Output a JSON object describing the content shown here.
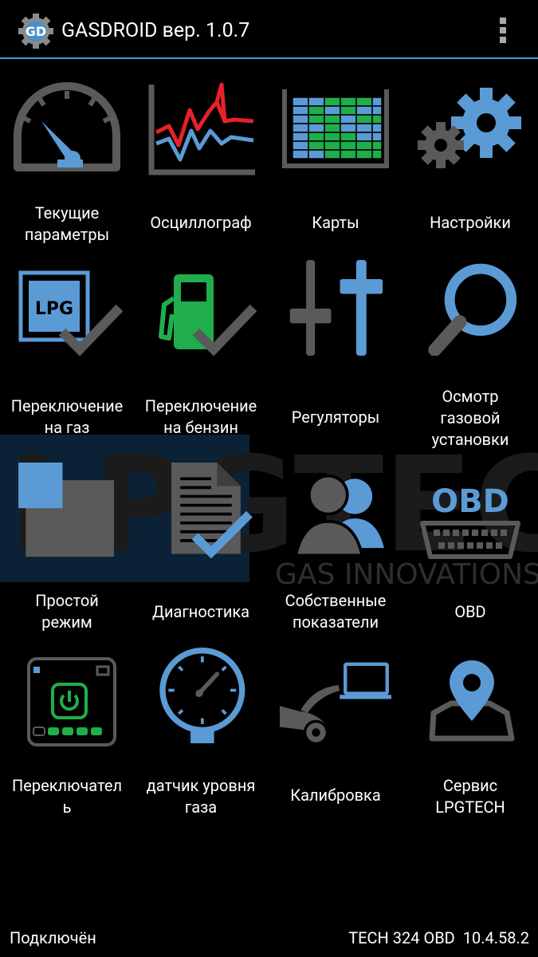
{
  "header": {
    "title": "GASDROID вер. 1.0.7",
    "logo_letters": "GD",
    "menu_icon": "overflow-menu-icon"
  },
  "watermark": {
    "brand": "LPGTECH",
    "tagline": "GAS INNOVATIONS"
  },
  "tiles": [
    {
      "label": "Текущие\nпараметры",
      "icon": "speedometer-icon"
    },
    {
      "label": "Осциллограф",
      "icon": "oscillograph-icon"
    },
    {
      "label": "Карты",
      "icon": "map-grid-icon"
    },
    {
      "label": "Настройки",
      "icon": "gears-icon"
    },
    {
      "label": "Переключение\nна газ",
      "icon": "lpg-check-icon",
      "icon_text": "LPG"
    },
    {
      "label": "Переключение\nна бензин",
      "icon": "fuel-pump-check-icon"
    },
    {
      "label": "Регуляторы",
      "icon": "sliders-icon"
    },
    {
      "label": "Осмотр\nгазовой\nустановки",
      "icon": "magnifier-icon"
    },
    {
      "label": "Простой\nрежим",
      "icon": "simple-mode-icon"
    },
    {
      "label": "Диагностика",
      "icon": "diagnostics-document-icon"
    },
    {
      "label": "Собственные\nпоказатели",
      "icon": "users-icon"
    },
    {
      "label": "OBD",
      "icon": "obd-connector-icon",
      "icon_text": "OBD"
    },
    {
      "label": "Переключател\nь",
      "icon": "switch-panel-icon"
    },
    {
      "label": "датчик уровня\nгаза",
      "icon": "gas-level-gauge-icon"
    },
    {
      "label": "Калибровка",
      "icon": "car-laptop-icon"
    },
    {
      "label": "Сервис\nLPGTECH",
      "icon": "map-pin-icon"
    }
  ],
  "footer": {
    "status": "Подключён",
    "device": "TECH 324 OBD  10.4.58.2"
  },
  "colors": {
    "accent": "#33a3dc",
    "icon_blue": "#5b9bd5",
    "icon_gray": "#5a5a5a",
    "green": "#1fae4b",
    "red": "#e8202a"
  }
}
